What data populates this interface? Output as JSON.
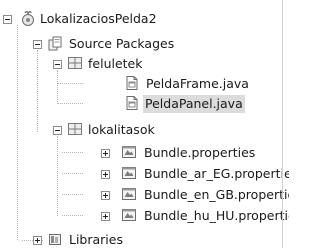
{
  "tree": {
    "project": {
      "label": "LokalizaciosPelda2",
      "icon": "project-icon"
    },
    "source_packages": {
      "label": "Source Packages",
      "icon": "source-packages-icon"
    },
    "package_feluletek": {
      "label": "feluletek",
      "icon": "package-icon",
      "files": [
        {
          "label": "PeldaFrame.java",
          "icon": "java-form-icon",
          "selected": false
        },
        {
          "label": "PeldaPanel.java",
          "icon": "java-form-icon",
          "selected": true
        }
      ]
    },
    "package_lokalitasok": {
      "label": "lokalitasok",
      "icon": "package-icon",
      "files": [
        {
          "label": "Bundle.properties",
          "icon": "properties-file-icon"
        },
        {
          "label": "Bundle_ar_EG.properties",
          "icon": "properties-file-icon"
        },
        {
          "label": "Bundle_en_GB.properties",
          "icon": "properties-file-icon"
        },
        {
          "label": "Bundle_hu_HU.properties",
          "icon": "properties-file-icon"
        }
      ]
    },
    "libraries": {
      "label": "Libraries",
      "icon": "libraries-icon"
    }
  },
  "colors": {
    "selection": "#dcdcdc",
    "tree_lines": "#b5b5b5",
    "text": "#1a1a1a"
  }
}
